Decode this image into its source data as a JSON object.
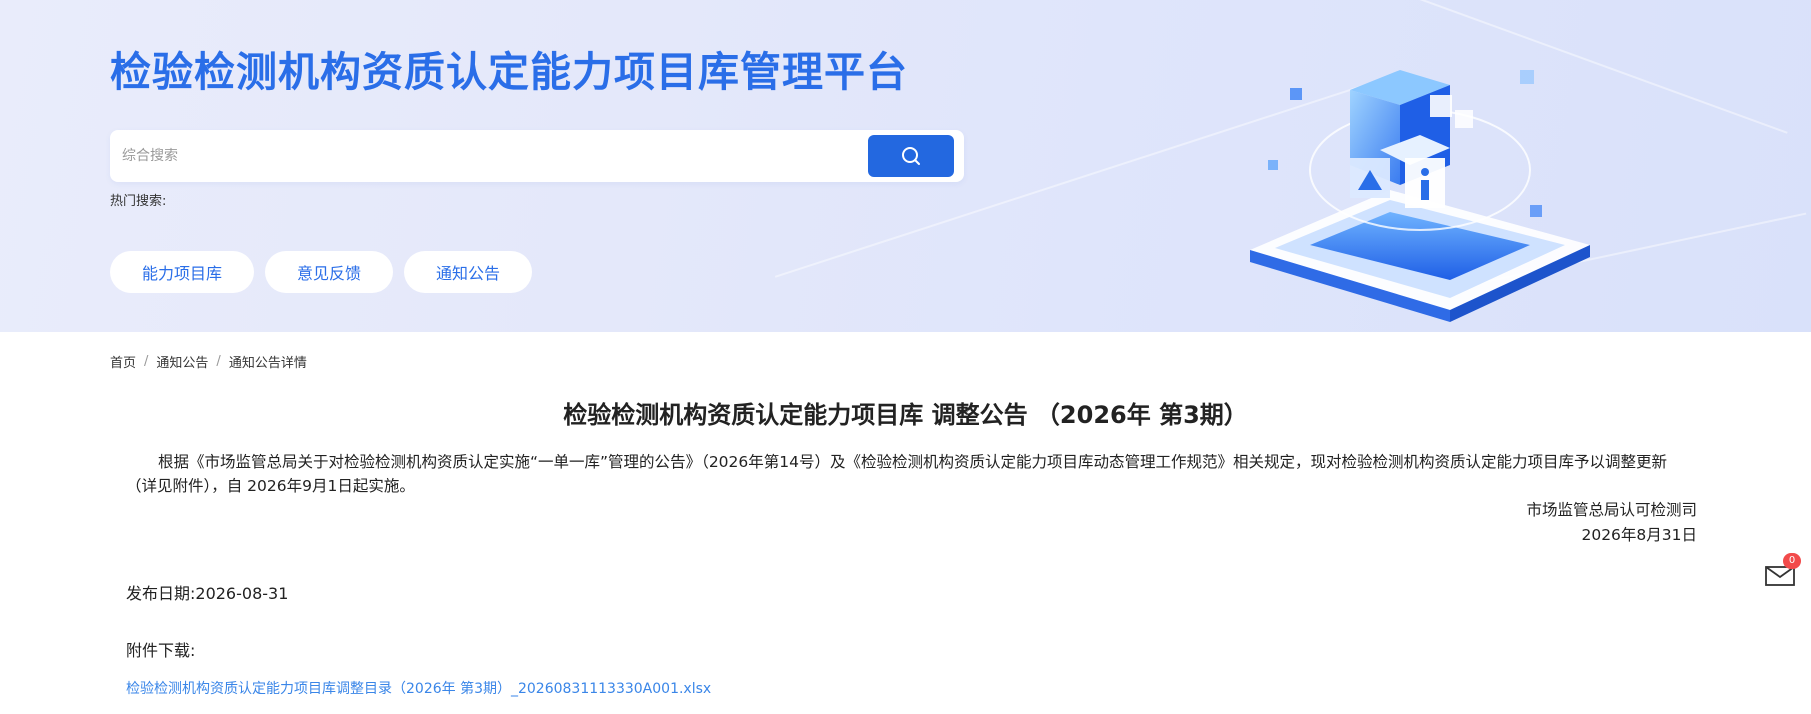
{
  "header": {
    "title": "检验检测机构资质认定能力项目库管理平台",
    "search": {
      "placeholder": "综合搜索",
      "value": ""
    },
    "hot_search_label": "热门搜索:",
    "nav": [
      {
        "label": "能力项目库"
      },
      {
        "label": "意见反馈"
      },
      {
        "label": "通知公告"
      }
    ]
  },
  "breadcrumb": {
    "items": [
      "首页",
      "通知公告",
      "通知公告详情"
    ],
    "separator": "/"
  },
  "article": {
    "title": "检验检测机构资质认定能力项目库 调整公告 （2026年 第3期）",
    "body": "根据《市场监管总局关于对检验检测机构资质认定实施“一单一库”管理的公告》（2026年第14号）及《检验检测机构资质认定能力项目库动态管理工作规范》相关规定，现对检验检测机构资质认定能力项目库予以调整更新（详见附件），自 2026年9月1日起实施。",
    "signature_org": "市场监管总局认可检测司",
    "signature_date": "2026年8月31日",
    "publish_date": "发布日期:2026-08-31",
    "attachment_label": "附件下载:",
    "attachment_link": "检验检测机构资质认定能力项目库调整目录（2026年 第3期）_20260831113330A001.xlsx"
  },
  "floating_message": {
    "badge_count": "0"
  },
  "colors": {
    "brand_blue": "#2a6ee8",
    "search_button": "#2368e0",
    "link": "#3a86e8",
    "badge": "#f24b4b"
  },
  "icons": [
    "search-icon",
    "mail-icon"
  ]
}
